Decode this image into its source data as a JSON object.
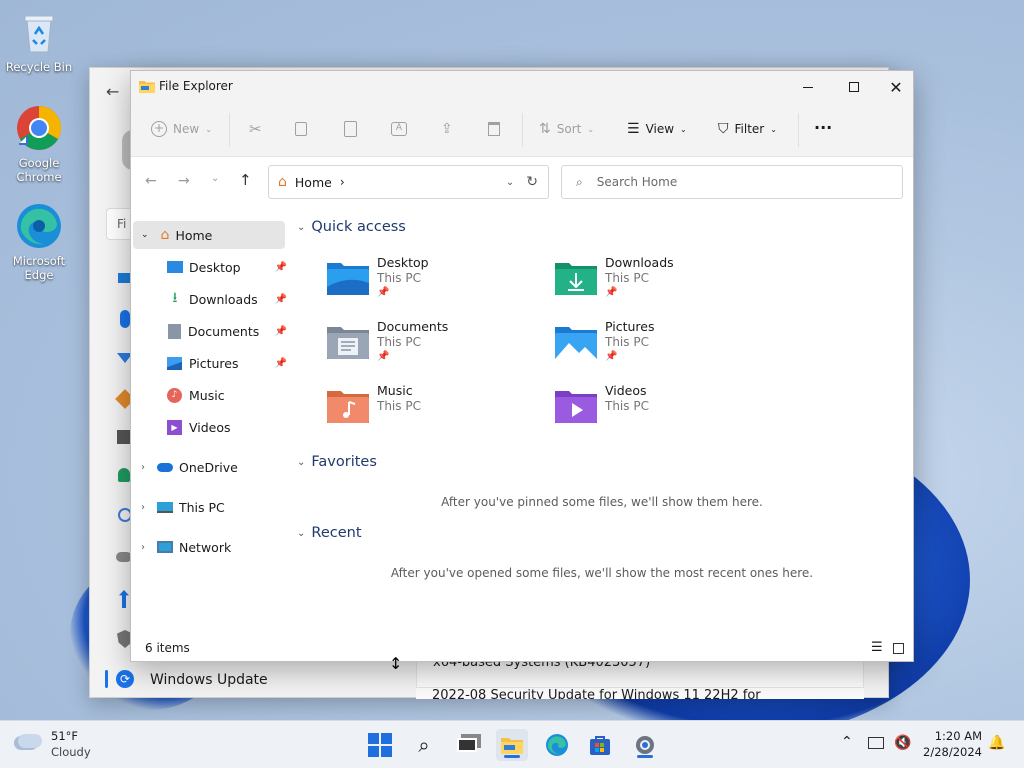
{
  "desktop": {
    "icons": [
      {
        "label": "Recycle Bin"
      },
      {
        "label": "Google Chrome"
      },
      {
        "label": "Microsoft Edge"
      }
    ]
  },
  "settings_window": {
    "search_placeholder": "Fi",
    "nav_bottom_label": "Windows Update",
    "content_line1": "x64-based Systems (KB4023057)",
    "content_line2": "2022-08 Security Update for Windows 11 22H2 for"
  },
  "explorer": {
    "title": "File Explorer",
    "commands": {
      "new": "New",
      "sort": "Sort",
      "view": "View",
      "filter": "Filter",
      "more": "···"
    },
    "address": {
      "location": "Home",
      "separator": "›",
      "search_placeholder": "Search Home"
    },
    "nav": {
      "home": "Home",
      "pinned": [
        {
          "label": "Desktop"
        },
        {
          "label": "Downloads"
        },
        {
          "label": "Documents"
        },
        {
          "label": "Pictures"
        },
        {
          "label": "Music"
        },
        {
          "label": "Videos"
        }
      ],
      "onedrive": "OneDrive",
      "thispc": "This PC",
      "network": "Network"
    },
    "sections": {
      "quick_access": "Quick access",
      "favorites": "Favorites",
      "recent": "Recent",
      "favorites_empty": "After you've pinned some files, we'll show them here.",
      "recent_empty": "After you've opened some files, we'll show the most recent ones here."
    },
    "quick_access": [
      {
        "name": "Desktop",
        "location": "This PC",
        "pinned": true
      },
      {
        "name": "Downloads",
        "location": "This PC",
        "pinned": true
      },
      {
        "name": "Documents",
        "location": "This PC",
        "pinned": true
      },
      {
        "name": "Pictures",
        "location": "This PC",
        "pinned": true
      },
      {
        "name": "Music",
        "location": "This PC",
        "pinned": false
      },
      {
        "name": "Videos",
        "location": "This PC",
        "pinned": false
      }
    ],
    "status": "6 items"
  },
  "taskbar": {
    "weather": {
      "temp": "51°F",
      "condition": "Cloudy"
    },
    "clock": {
      "time": "1:20 AM",
      "date": "2/28/2024"
    },
    "apps": [
      "start",
      "search",
      "task-view",
      "file-explorer",
      "edge",
      "store",
      "settings"
    ],
    "colors": {
      "accent": "#2b6fd6",
      "start": "#1f6fe0"
    }
  }
}
